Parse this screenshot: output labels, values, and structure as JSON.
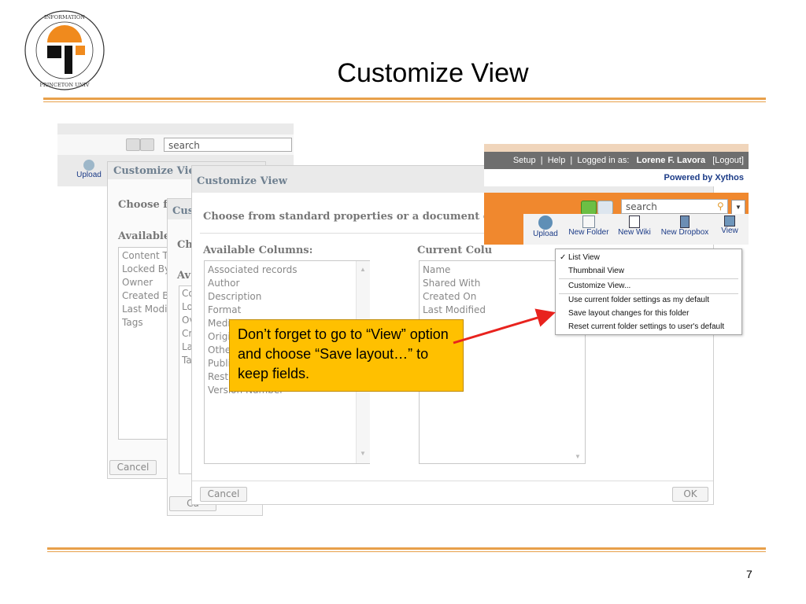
{
  "slide": {
    "title": "Customize View",
    "page_number": "7",
    "logo_text": "OFFICE of INFORMATION TECHNOLOGY · PRINCETON UNIVERSITY"
  },
  "colors": {
    "accent_orange": "#e8a04a",
    "callout": "#ffc000",
    "app_orange": "#f0882e",
    "arrow": "#e8231e",
    "brand_blue": "#1b3b87"
  },
  "back_window": {
    "search_value": "search",
    "upload_label": "Upload"
  },
  "dialog1": {
    "title": "Customize View",
    "prompt": "Choose fr",
    "available_label": "Available",
    "columns": [
      "Content T",
      "Locked By",
      "Owner",
      "Created B",
      "Last Modif",
      "Tags"
    ],
    "cancel": "Cancel"
  },
  "dialog2": {
    "title": "Cus",
    "prompt": "Ch",
    "available_label": "Av",
    "columns": [
      "Co",
      "Lo",
      "Ov",
      "Cr",
      "La",
      "Ta"
    ],
    "cancel": "Ca"
  },
  "dialog3": {
    "title": "Customize View",
    "prompt": "Choose from standard properties or a document cla",
    "available_label": "Available Columns:",
    "current_label": "Current Colu",
    "available_columns": [
      "Associated records",
      "Author",
      "Description",
      "Format",
      "Media T",
      "Origi",
      "Othe",
      "Publi",
      "Rest",
      "Version Number"
    ],
    "current_columns": [
      "Name",
      "Shared With",
      "Created On",
      "Last Modified"
    ],
    "cancel": "Cancel",
    "ok": "OK"
  },
  "app": {
    "setup": "Setup",
    "help": "Help",
    "logged_in_as": "Logged in as:",
    "user_name": "Lorene F. Lavora",
    "logout": "[Logout]",
    "powered_by": "Powered by Xythos",
    "search_value": "search",
    "toolbar": [
      {
        "label": "Upload",
        "icon": "globe-upload-icon"
      },
      {
        "label": "New Folder",
        "icon": "new-folder-icon"
      },
      {
        "label": "New Wiki",
        "icon": "new-wiki-icon"
      },
      {
        "label": "New Dropbox",
        "icon": "new-dropbox-icon"
      },
      {
        "label": "View",
        "icon": "view-icon"
      }
    ]
  },
  "view_menu": {
    "items": [
      {
        "label": "List View",
        "checked": true
      },
      {
        "label": "Thumbnail View",
        "checked": false
      },
      {
        "label": "Customize View...",
        "checked": false
      },
      {
        "label": "Use current folder settings as my default",
        "checked": false
      },
      {
        "label": "Save layout changes for this folder",
        "checked": false
      },
      {
        "label": "Reset current folder settings to user's default",
        "checked": false
      }
    ]
  },
  "callout": {
    "text": "Don’t forget to go to “View” option and choose “Save layout…” to keep fields."
  }
}
